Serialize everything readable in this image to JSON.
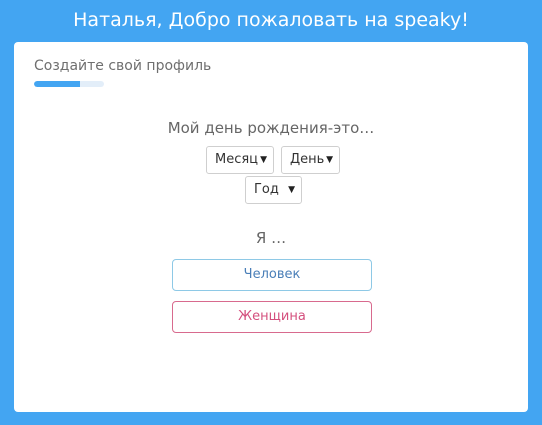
{
  "header": {
    "welcome": "Наталья, Добро пожаловать на speaky!"
  },
  "card": {
    "title": "Создайте свой профиль",
    "progress": 0.65,
    "birthday_label": "Мой день рождения-это…",
    "month_value": "Месяц",
    "day_value": "День",
    "year_value": "Год",
    "i_am_label": "Я …",
    "human_button": "Человек",
    "woman_button": "Женщина"
  },
  "colors": {
    "background": "#43a5f2",
    "progress": "#43a5f2",
    "human_border": "#8ec9e6",
    "woman_border": "#d86a8e"
  }
}
